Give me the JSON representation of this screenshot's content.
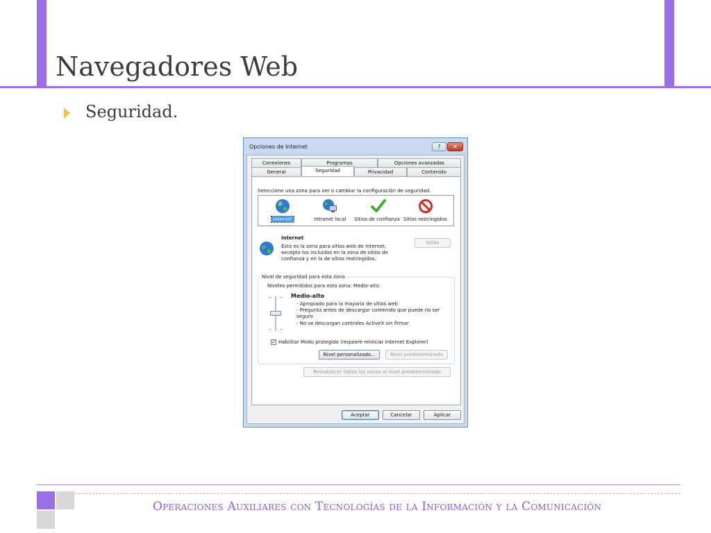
{
  "slide": {
    "title": "Navegadores Web",
    "bullet": "Seguridad.",
    "footer": "Operaciones Auxiliares con Tecnologías de la Información y la Comunicación",
    "accent_color": "#9b6fe8",
    "bullet_color": "#f0c34c"
  },
  "dialog": {
    "title": "Opciones de Internet",
    "help_label": "?",
    "close_label": "✕",
    "tabs_row1": [
      "Conexiones",
      "Programas",
      "Opciones avanzadas"
    ],
    "tabs_row2": [
      "General",
      "Seguridad",
      "Privacidad",
      "Contenido"
    ],
    "active_tab": "Seguridad",
    "zone_prompt": "Seleccione una zona para ver o cambiar la configuración de seguridad.",
    "zones": [
      {
        "label": "Internet",
        "icon": "globe-icon",
        "selected": true
      },
      {
        "label": "Intranet local",
        "icon": "intranet-icon",
        "selected": false
      },
      {
        "label": "Sitios de confianza",
        "icon": "checkmark-icon",
        "selected": false
      },
      {
        "label": "Sitios restringidos",
        "icon": "prohibited-icon",
        "selected": false
      }
    ],
    "zone_info": {
      "name": "Internet",
      "line1": "Ésta es la zona para sitios web de Internet,",
      "line2": "excepto los incluidos en la zona de sitios de",
      "line3": "confianza y en la de sitios restringidos.",
      "sites_button": "Sitios"
    },
    "security_level": {
      "group_label": "Nivel de seguridad para esta zona",
      "allowed": "Niveles permitidos para esta zona: Medio-alto",
      "level_name": "Medio-alto",
      "detail1": "- Apropiado para la mayoría de sitios web",
      "detail2": "- Pregunta antes de descargar contenido que puede no ser",
      "detail2b": "seguro",
      "detail3": "- No se descargan controles ActiveX sin firmar",
      "protected_mode": "Habilitar Modo protegido (requiere reiniciar Internet Explorer)",
      "protected_mode_checked": true,
      "custom_button": "Nivel personalizado...",
      "default_button": "Nivel predeterminado"
    },
    "reset_button": "Restablecer todas las zonas al nivel predeterminado",
    "ok_button": "Aceptar",
    "cancel_button": "Cancelar",
    "apply_button": "Aplicar"
  }
}
